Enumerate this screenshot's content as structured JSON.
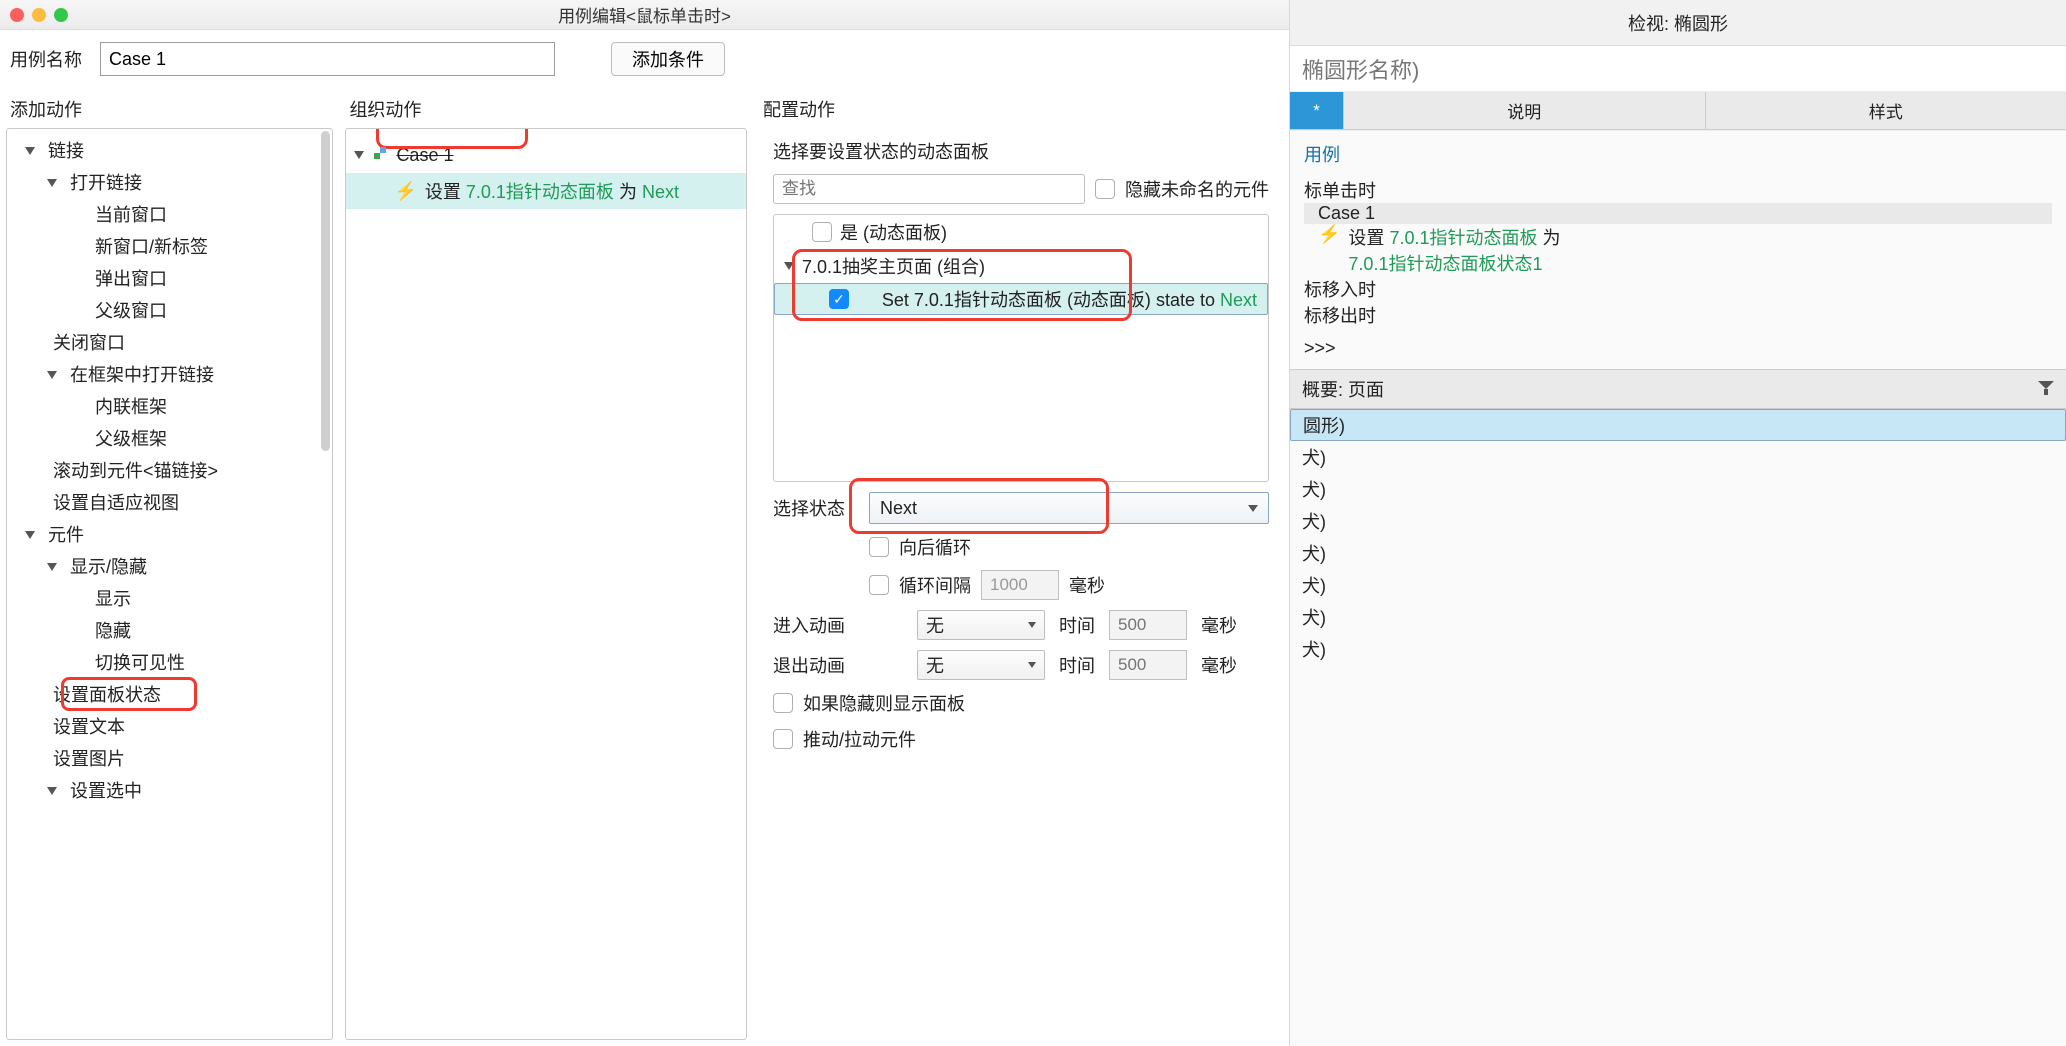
{
  "dialog": {
    "title": "用例编辑<鼠标单击时>",
    "case_name_label": "用例名称",
    "case_name_value": "Case 1",
    "add_condition": "添加条件",
    "add_action_header": "添加动作",
    "organize_header": "组织动作",
    "configure_header": "配置动作"
  },
  "actions_tree": {
    "links": "链接",
    "open_link": "打开链接",
    "current_window": "当前窗口",
    "new_window": "新窗口/新标签",
    "popup_window": "弹出窗口",
    "parent_window": "父级窗口",
    "close_window": "关闭窗口",
    "open_in_frame": "在框架中打开链接",
    "inline_frame": "内联框架",
    "parent_frame": "父级框架",
    "scroll_anchor": "滚动到元件<锚链接>",
    "set_adaptive": "设置自适应视图",
    "widgets": "元件",
    "show_hide": "显示/隐藏",
    "show": "显示",
    "hide": "隐藏",
    "toggle_vis": "切换可见性",
    "set_panel_state": "设置面板状态",
    "set_text": "设置文本",
    "set_image": "设置图片",
    "set_selected": "设置选中"
  },
  "org": {
    "case_label": "Case 1",
    "action_prefix": "设置",
    "action_target": "7.0.1指针动态面板",
    "action_mid": " 为 ",
    "action_state": "Next"
  },
  "cfg": {
    "select_panel_title": "选择要设置状态的动态面板",
    "search_placeholder": "查找",
    "hide_unnamed": "隐藏未命名的元件",
    "is_panel": "是 (动态面板)",
    "group_name": "7.0.1抽奖主页面 (组合)",
    "set_prefix": "Set ",
    "set_target": "7.0.1指针动态面板 (动态面板)",
    "set_mid": " state to ",
    "set_state": "Next",
    "select_state_label": "选择状态",
    "select_state_value": "Next",
    "loop_back": "向后循环",
    "loop_interval": "循环间隔",
    "loop_value": "1000",
    "ms": "毫秒",
    "enter_anim": "进入动画",
    "exit_anim": "退出动画",
    "anim_none": "无",
    "time_label": "时间",
    "time_value": "500",
    "if_hidden": "如果隐藏则显示面板",
    "push_pull": "推动/拉动元件"
  },
  "inspector": {
    "title": "检视: 椭圆形",
    "name_placeholder": "椭圆形名称)",
    "tab_star": "*",
    "tab_notes": "说明",
    "tab_style": "样式",
    "interactions": "用例",
    "evt_click": "标单击时",
    "case1": "Case 1",
    "act_prefix": "设置 ",
    "act_target": "7.0.1指针动态面板",
    "act_mid": " 为 ",
    "act_state": "7.0.1指针动态面板状态1",
    "evt_mousein": "标移入时",
    "evt_mouseout": "标移出时",
    "more": ">>>"
  },
  "summary": {
    "title": "概要: 页面",
    "items": [
      "圆形)",
      "犬)",
      "犬)",
      "犬)",
      "犬)",
      "犬)",
      "犬)",
      "犬)"
    ]
  }
}
